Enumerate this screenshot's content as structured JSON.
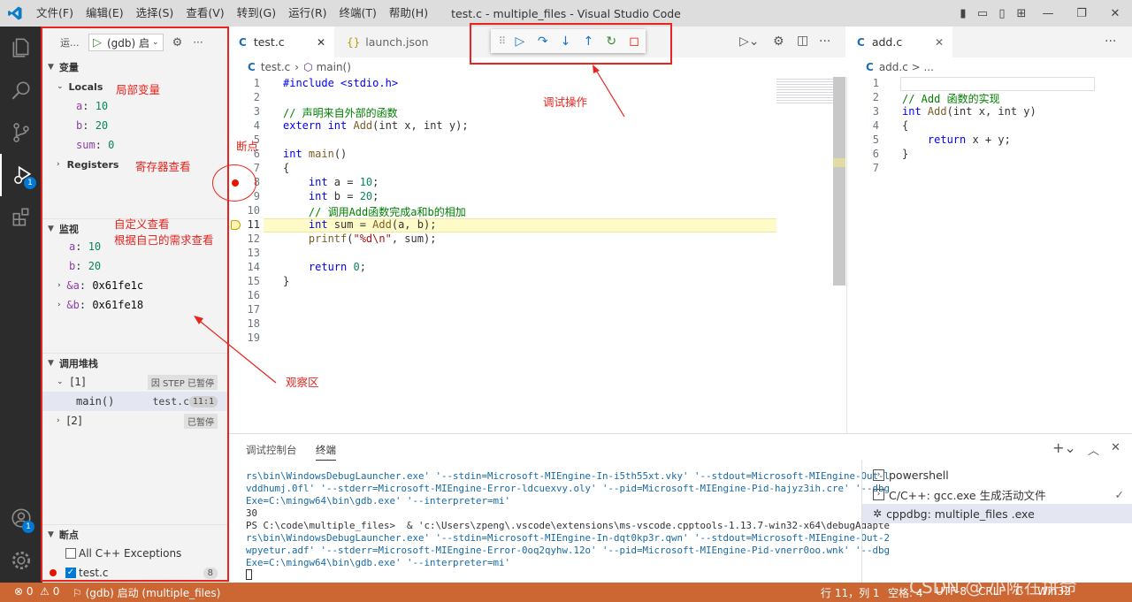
{
  "titlebar": {
    "menus": [
      "文件(F)",
      "编辑(E)",
      "选择(S)",
      "查看(V)",
      "转到(G)",
      "运行(R)",
      "终端(T)",
      "帮助(H)"
    ],
    "title": "test.c - multiple_files - Visual Studio Code"
  },
  "activity": {
    "debug_badge": "1",
    "account_badge": "1"
  },
  "sidebar": {
    "run_label": "运...",
    "config": "(gdb) 启",
    "variables_title": "变量",
    "locals_label": "Locals",
    "locals": [
      {
        "name": "a",
        "value": "10"
      },
      {
        "name": "b",
        "value": "20"
      },
      {
        "name": "sum",
        "value": "0"
      }
    ],
    "registers_label": "Registers",
    "watch_title": "监视",
    "watch": [
      {
        "name": "a",
        "value": "10"
      },
      {
        "name": "b",
        "value": "20"
      },
      {
        "name": "&a",
        "value": "0x61fe1c"
      },
      {
        "name": "&b",
        "value": "0x61fe18"
      }
    ],
    "callstack_title": "调用堆栈",
    "thread1": "[1]",
    "thread1_status": "因 STEP 已暂停",
    "frame_name": "main()",
    "frame_file": "test.c",
    "frame_pos": "11:1",
    "thread2": "[2]",
    "thread2_status": "已暂停",
    "breakpoints_title": "断点",
    "bp_exceptions": "All C++ Exceptions",
    "bp_file": "test.c",
    "bp_count": "8"
  },
  "editor": {
    "tab1": "test.c",
    "tab2": "launch.json",
    "crumb_file": "test.c",
    "crumb_fn": "main()",
    "line_numbers": [
      "1",
      "2",
      "3",
      "4",
      "5",
      "6",
      "7",
      "8",
      "9",
      "10",
      "11",
      "12",
      "13",
      "14",
      "15",
      "16",
      "17",
      "18",
      "19"
    ],
    "code": {
      "l1": "#include <stdio.h>",
      "l3": "// 声明来自外部的函数",
      "l4a": "extern ",
      "l4b": "int ",
      "l4c": "Add",
      "l4d": "(int x, int y);",
      "l6a": "int ",
      "l6b": "main",
      "l6c": "()",
      "l7": "{",
      "l8a": "    int ",
      "l8b": "a = ",
      "l8c": "10",
      "l8d": ";",
      "l9a": "    int ",
      "l9b": "b = ",
      "l9c": "20",
      "l9d": ";",
      "l10": "    // 调用Add函数完成a和b的相加",
      "l11a": "    int ",
      "l11b": "sum = ",
      "l11c": "Add",
      "l11d": "(a, b);",
      "l12a": "    printf",
      "l12b": "(",
      "l12c": "\"%d\\n\"",
      "l12d": ", sum);",
      "l14a": "    return ",
      "l14b": "0",
      "l14c": ";",
      "l15": "}"
    }
  },
  "right_editor": {
    "tab": "add.c",
    "crumb": "add.c > ...",
    "line_numbers": [
      "1",
      "2",
      "3",
      "4",
      "5",
      "6",
      "7"
    ],
    "code": {
      "l2": "// Add 函数的实现",
      "l3a": "int ",
      "l3b": "Add",
      "l3c": "(int x, int y)",
      "l4": "{",
      "l5a": "    return ",
      "l5b": "x + y;",
      "l6": "}"
    }
  },
  "panel": {
    "tab_debug_console": "调试控制台",
    "tab_terminal": "终端",
    "terminal_lines": [
      "rs\\bin\\WindowsDebugLauncher.exe' '--stdin=Microsoft-MIEngine-In-i5th55xt.vky' '--stdout=Microsoft-MIEngine-Out-l",
      "vddhumj.0fl' '--stderr=Microsoft-MIEngine-Error-ldcuexvy.oly' '--pid=Microsoft-MIEngine-Pid-hajyz3ih.cre' '--dbg",
      "Exe=C:\\mingw64\\bin\\gdb.exe' '--interpreter=mi'",
      "30",
      "PS C:\\code\\multiple_files>  & 'c:\\Users\\zpeng\\.vscode\\extensions\\ms-vscode.cpptools-1.13.7-win32-x64\\debugAdapte",
      "rs\\bin\\WindowsDebugLauncher.exe' '--stdin=Microsoft-MIEngine-In-dqt0kp3r.qwn' '--stdout=Microsoft-MIEngine-Out-2",
      "wpyetur.adf' '--stderr=Microsoft-MIEngine-Error-0oq2qyhw.12o' '--pid=Microsoft-MIEngine-Pid-vnerr0oo.wnk' '--dbg",
      "Exe=C:\\mingw64\\bin\\gdb.exe' '--interpreter=mi'"
    ],
    "terminals": [
      "powershell",
      "C/C++: gcc.exe 生成活动文件",
      "cppdbg: multiple_files .exe"
    ]
  },
  "status": {
    "errors": "0",
    "warnings": "0",
    "debug_config": "(gdb) 启动 (multiple_files)",
    "position": "行 11，列 1",
    "spaces": "空格: 4",
    "encoding": "UTF-8",
    "eol": "CRLF",
    "lang": "C",
    "platform": "Win32",
    "watermark": "CSDN @ 小陈在拼命"
  },
  "annotations": {
    "locals": "局部变量",
    "registers": "寄存器查看",
    "breakpoint": "断点",
    "watch1": "自定义查看",
    "watch2": "根据自己的需求查看",
    "debug_ops": "调试操作",
    "observe": "观察区"
  },
  "colors": {
    "accent": "#0078d4",
    "status_bar": "#cc6633",
    "annotation": "#e8241e",
    "activity_bar": "#2c2c2c"
  }
}
